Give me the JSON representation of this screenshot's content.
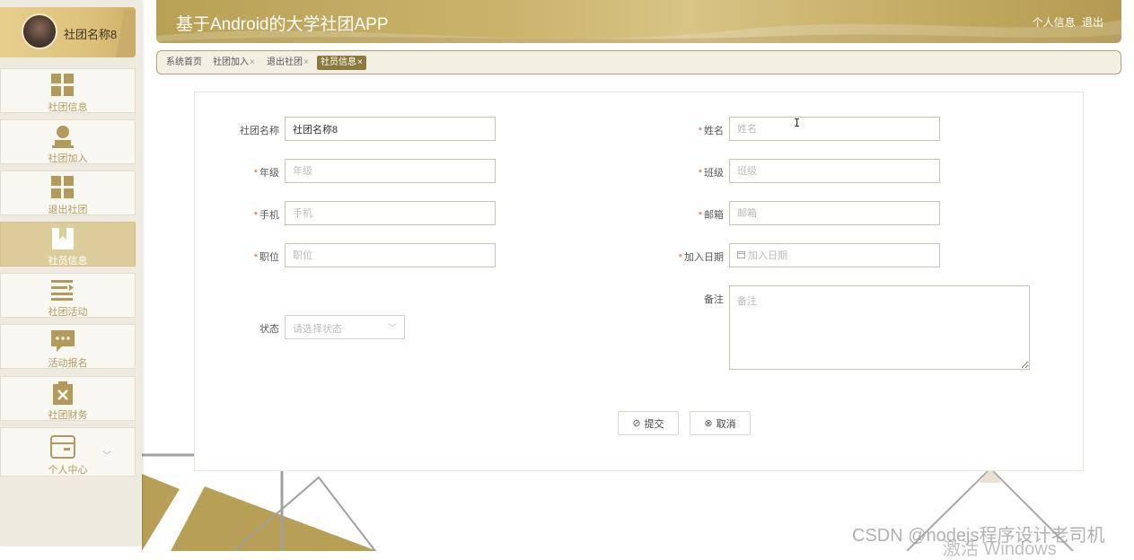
{
  "sidebar": {
    "profile_name": "社团名称8",
    "items": [
      {
        "label": "社团信息",
        "icon": "grid-icon",
        "active": false
      },
      {
        "label": "社团加入",
        "icon": "user-icon",
        "active": false
      },
      {
        "label": "退出社团",
        "icon": "grid-icon",
        "active": false
      },
      {
        "label": "社员信息",
        "icon": "bookmark-icon",
        "active": true
      },
      {
        "label": "社团活动",
        "icon": "list-icon",
        "active": false
      },
      {
        "label": "活动报名",
        "icon": "chat-icon",
        "active": false
      },
      {
        "label": "社团财务",
        "icon": "clipboard-x-icon",
        "active": false
      },
      {
        "label": "个人中心",
        "icon": "card-icon",
        "active": false
      }
    ]
  },
  "header": {
    "title": "基于Android的大学社团APP",
    "profile_link": "个人信息",
    "logout_link": "退出"
  },
  "tabs": [
    {
      "label": "系统首页",
      "closable": false,
      "active": false
    },
    {
      "label": "社团加入",
      "closable": true,
      "active": false
    },
    {
      "label": "退出社团",
      "closable": true,
      "active": false
    },
    {
      "label": "社员信息",
      "closable": true,
      "active": true
    }
  ],
  "tab_close_glyph": "×",
  "form": {
    "club_name": {
      "label": "社团名称",
      "value": "社团名称8",
      "required": false
    },
    "name": {
      "label": "姓名",
      "placeholder": "姓名",
      "required": true
    },
    "grade": {
      "label": "年级",
      "placeholder": "年级",
      "required": true
    },
    "class": {
      "label": "班级",
      "placeholder": "班级",
      "required": true
    },
    "phone": {
      "label": "手机",
      "placeholder": "手机",
      "required": true
    },
    "email": {
      "label": "邮箱",
      "placeholder": "邮箱",
      "required": true
    },
    "position": {
      "label": "职位",
      "placeholder": "职位",
      "required": true
    },
    "join_date": {
      "label": "加入日期",
      "placeholder": "加入日期",
      "required": true
    },
    "status": {
      "label": "状态",
      "placeholder": "请选择状态"
    },
    "remarks": {
      "label": "备注",
      "placeholder": "备注"
    },
    "required_mark": "*",
    "submit_label": "提交",
    "cancel_label": "取消"
  },
  "colors": {
    "accent": "#c4ab63",
    "active_tab": "#8d7a3f",
    "required": "#e05a4e"
  },
  "watermarks": {
    "csdn": "CSDN @nodejs程序设计老司机",
    "windows": "激活 Windows"
  }
}
